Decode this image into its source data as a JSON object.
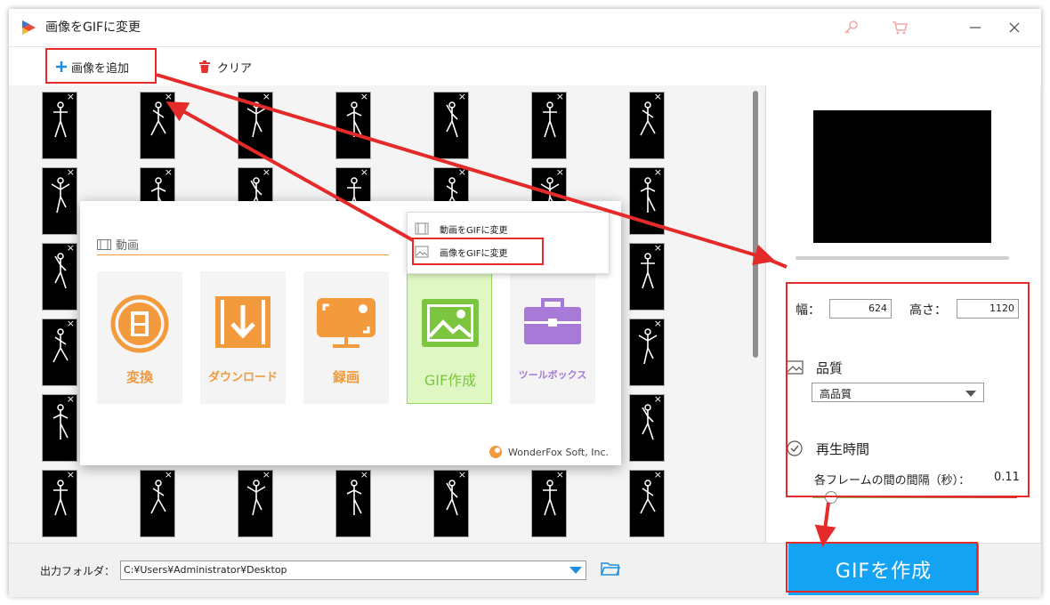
{
  "window": {
    "title": "画像をGIFに変更",
    "accent": "#14a3f2",
    "annotation_color": "#e52a2a"
  },
  "titlebar_buttons": [
    "key-icon",
    "cart-icon",
    "minimize-icon",
    "close-icon"
  ],
  "toolbar": {
    "add_images": "画像を追加",
    "clear": "クリア"
  },
  "thumbnails": {
    "columns": 7,
    "rows": 6,
    "content": "stick-figure-frames"
  },
  "popup": {
    "section": "動画",
    "cards": [
      {
        "label": "変換",
        "icon": "film-convert-icon",
        "color": "#f29a3c"
      },
      {
        "label": "ダウンロード",
        "icon": "download-icon",
        "color": "#f29a3c"
      },
      {
        "label": "録画",
        "icon": "screen-record-icon",
        "color": "#f29a3c"
      },
      {
        "label": "GIF作成",
        "icon": "gif-image-icon",
        "color": "#7cc63f",
        "selected": true
      },
      {
        "label": "ツールボックス",
        "icon": "toolbox-icon",
        "color": "#a67ad6"
      }
    ],
    "brand": "WonderFox Soft, Inc.",
    "submenu": [
      "動画をGIFに変更",
      "画像をGIFに変更"
    ]
  },
  "settings": {
    "width_label": "幅：",
    "width_value": "624",
    "height_label": "高さ：",
    "height_value": "1120",
    "quality_label": "品質",
    "quality_value": "高品質",
    "playback_label": "再生時間",
    "interval_label": "各フレームの間の間隔（秒）：",
    "interval_value": "0.11",
    "interval_level": 0.06
  },
  "output": {
    "label": "出力フォルダ：",
    "path": "C:¥Users¥Administrator¥Desktop"
  },
  "create_button": "GIFを作成"
}
